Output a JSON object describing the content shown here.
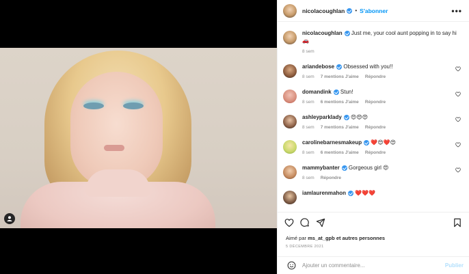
{
  "post": {
    "author": "nicolacoughlan",
    "follow_label": "S'abonner",
    "separator": "•",
    "more_label": "•••",
    "caption": {
      "author": "nicolacoughlan",
      "text": "Just me, your cool aunt popping in to say hi 🚗",
      "time": "8 sem"
    }
  },
  "comments": [
    {
      "user": "ariandebose",
      "text": "Obsessed with you!!",
      "time": "8 sem",
      "likes": "7 mentions J'aime",
      "reply": "Répondre",
      "verified": true
    },
    {
      "user": "domandink",
      "text": "Stun!",
      "time": "8 sem",
      "likes": "6 mentions J'aime",
      "reply": "Répondre",
      "verified": true
    },
    {
      "user": "ashleyparklady",
      "text": "😍😍😍",
      "time": "8 sem",
      "likes": "7 mentions J'aime",
      "reply": "Répondre",
      "verified": true
    },
    {
      "user": "carolinebarnesmakeup",
      "text": "❤️😍❤️😍",
      "time": "8 sem",
      "likes": "6 mentions J'aime",
      "reply": "Répondre",
      "verified": true
    },
    {
      "user": "mammybanter",
      "text": "Gorgeous girl 😍",
      "time": "8 sem",
      "likes": "",
      "reply": "Répondre",
      "verified": true
    },
    {
      "user": "iamlaurenmahon",
      "text": "❤️❤️❤️",
      "time": "",
      "likes": "",
      "reply": "",
      "verified": true
    }
  ],
  "footer": {
    "liked_prefix": "Aimé par",
    "liked_user": "ms_at_gpb",
    "liked_suffix": "et autres personnes",
    "date": "5 DÉCEMBRE 2021",
    "comment_placeholder": "Ajouter un commentaire...",
    "publish_label": "Publier"
  },
  "icons": [
    "user-tag-icon",
    "verified-badge-icon",
    "more-options-icon",
    "heart-icon",
    "like-icon",
    "comment-icon",
    "share-icon",
    "save-icon",
    "emoji-icon"
  ],
  "colors": {
    "accent": "#0095f6",
    "verified": "#3897f0",
    "muted": "#8e8e8e",
    "publish_disabled": "#b2dffc"
  }
}
